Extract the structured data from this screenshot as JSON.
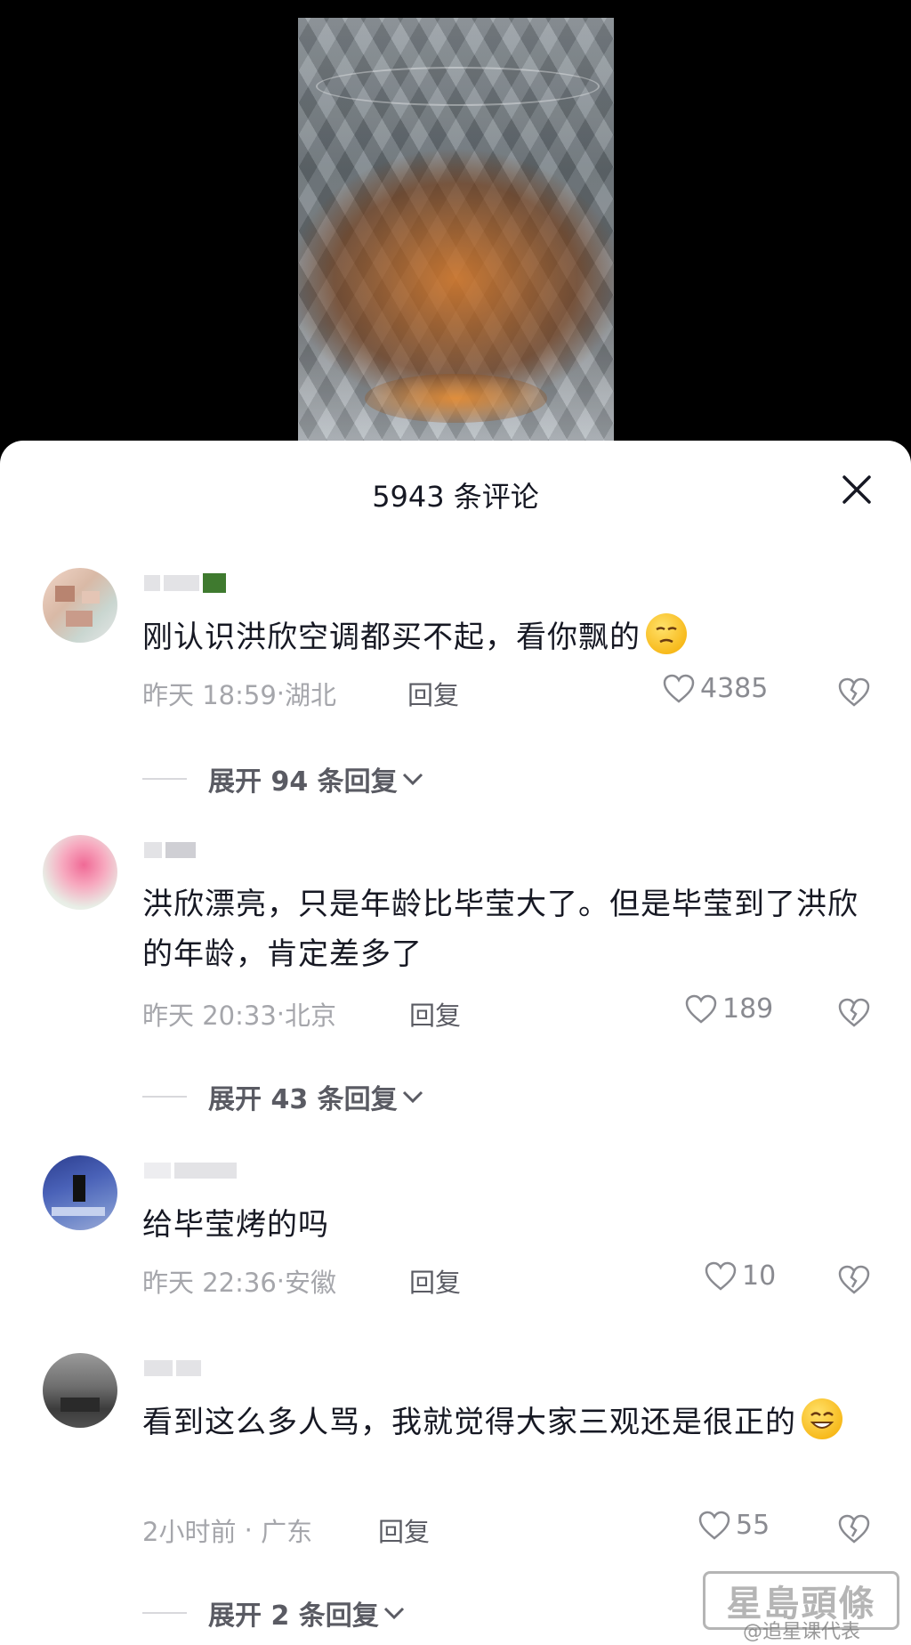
{
  "video": {},
  "sheet": {
    "title": "5943 条评论"
  },
  "comments": [
    {
      "text": "刚认识洪欣空调都买不起，看你飘的",
      "time": "昨天 18:59",
      "location": "湖北",
      "reply_label": "回复",
      "likes": "4385",
      "expand": "展开 94 条回复",
      "emoji": "smirk-emoji"
    },
    {
      "text": "洪欣漂亮，只是年龄比毕莹大了。但是毕莹到了洪欣的年龄，肯定差多了",
      "time": "昨天 20:33",
      "location": "北京",
      "reply_label": "回复",
      "likes": "189",
      "expand": "展开 43 条回复"
    },
    {
      "text": "给毕莹烤的吗",
      "time": "昨天 22:36",
      "location": "安徽",
      "reply_label": "回复",
      "likes": "10"
    },
    {
      "text": "看到这么多人骂，我就觉得大家三观还是很正的",
      "time": "2小时前",
      "location": "广东",
      "reply_label": "回复",
      "likes": "55",
      "expand": "展开 2 条回复",
      "emoji": "grin-emoji"
    }
  ],
  "watermark": {
    "logo_text": "星島頭條",
    "weibo_text": "@追星课代表"
  }
}
